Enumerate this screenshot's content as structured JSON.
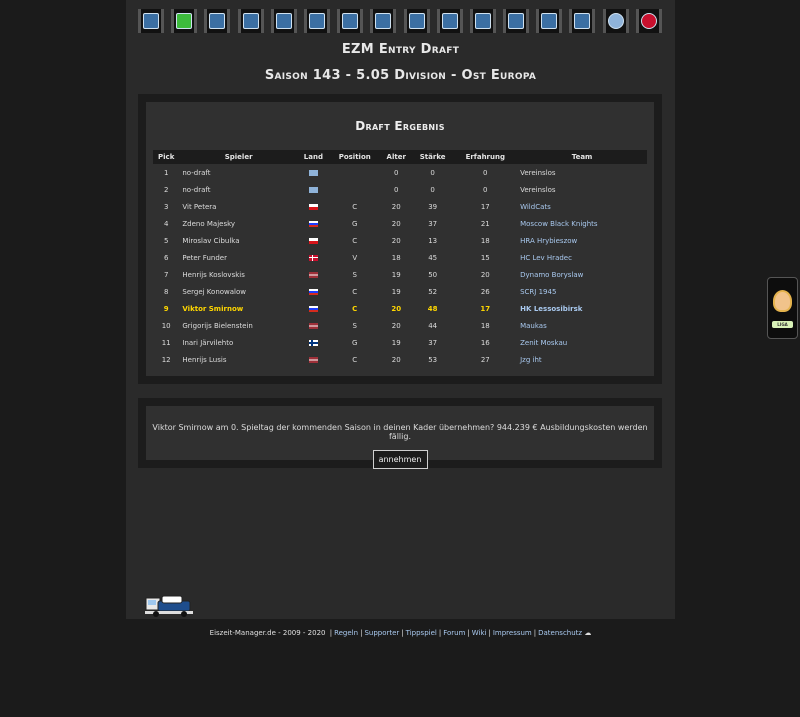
{
  "nav": {
    "icons": [
      "home-icon",
      "jersey-icon",
      "lineup-icon",
      "training-icon",
      "list-icon",
      "transfer-icon",
      "team-icon",
      "arena-icon",
      "finance-icon",
      "map-icon",
      "exchange-icon",
      "stats-icon",
      "mail-icon",
      "news-icon",
      "chat-icon",
      "logout-icon"
    ]
  },
  "header": {
    "title": "EZM Entry Draft",
    "subtitle": "Saison 143 - 5.05 Division - Ost Europa"
  },
  "draft": {
    "title": "Draft Ergebnis",
    "columns": [
      "Pick",
      "Spieler",
      "Land",
      "Position",
      "Alter",
      "Stärke",
      "Erfahrung",
      "Team"
    ],
    "rows": [
      {
        "pick": "1",
        "name": "no-draft",
        "flag": "un",
        "pos": "",
        "age": "0",
        "str": "0",
        "exp": "0",
        "team": "Vereinslos",
        "link": false,
        "hl": false
      },
      {
        "pick": "2",
        "name": "no-draft",
        "flag": "un",
        "pos": "",
        "age": "0",
        "str": "0",
        "exp": "0",
        "team": "Vereinslos",
        "link": false,
        "hl": false
      },
      {
        "pick": "3",
        "name": "Vit Petera",
        "flag": "cz",
        "pos": "C",
        "age": "20",
        "str": "39",
        "exp": "17",
        "team": "WildCats",
        "link": true,
        "hl": false
      },
      {
        "pick": "4",
        "name": "Zdeno Majesky",
        "flag": "ru",
        "pos": "G",
        "age": "20",
        "str": "37",
        "exp": "21",
        "team": "Moscow Black Knights",
        "link": true,
        "hl": false
      },
      {
        "pick": "5",
        "name": "Miroslav Cibulka",
        "flag": "cz",
        "pos": "C",
        "age": "20",
        "str": "13",
        "exp": "18",
        "team": "HRA Hrybieszow",
        "link": true,
        "hl": false
      },
      {
        "pick": "6",
        "name": "Peter Funder",
        "flag": "dk",
        "pos": "V",
        "age": "18",
        "str": "45",
        "exp": "15",
        "team": "HC Lev Hradec",
        "link": true,
        "hl": false
      },
      {
        "pick": "7",
        "name": "Henrijs Koslovskis",
        "flag": "lv",
        "pos": "S",
        "age": "19",
        "str": "50",
        "exp": "20",
        "team": "Dynamo Boryslaw",
        "link": true,
        "hl": false
      },
      {
        "pick": "8",
        "name": "Sergej Konowalow",
        "flag": "ru",
        "pos": "C",
        "age": "19",
        "str": "52",
        "exp": "26",
        "team": "SCRJ 1945",
        "link": true,
        "hl": false
      },
      {
        "pick": "9",
        "name": "Viktor Smirnow",
        "flag": "ru",
        "pos": "C",
        "age": "20",
        "str": "48",
        "exp": "17",
        "team": "HK Lessosibirsk",
        "link": true,
        "hl": true
      },
      {
        "pick": "10",
        "name": "Grigorijs Bielenstein",
        "flag": "lv",
        "pos": "S",
        "age": "20",
        "str": "44",
        "exp": "18",
        "team": "Maukas",
        "link": true,
        "hl": false
      },
      {
        "pick": "11",
        "name": "Inari Järvilehto",
        "flag": "fi",
        "pos": "G",
        "age": "19",
        "str": "37",
        "exp": "16",
        "team": "Zenit Moskau",
        "link": true,
        "hl": false
      },
      {
        "pick": "12",
        "name": "Henrijs Lusis",
        "flag": "lv",
        "pos": "C",
        "age": "20",
        "str": "53",
        "exp": "27",
        "team": "Jzg iht",
        "link": true,
        "hl": false
      }
    ]
  },
  "confirm": {
    "text": "Viktor Smirnow am 0. Spieltag der kommenden Saison in deinen Kader übernehmen? 944.239 € Ausbildungskosten werden fällig.",
    "button": "annehmen"
  },
  "footer": {
    "copyright": "Eiszeit-Manager.de - 2009 - 2020",
    "links": [
      "Regeln",
      "Supporter",
      "Tippspiel",
      "Forum",
      "Wiki",
      "Impressum",
      "Datenschutz"
    ]
  },
  "phone": {
    "button": "LIGA"
  }
}
